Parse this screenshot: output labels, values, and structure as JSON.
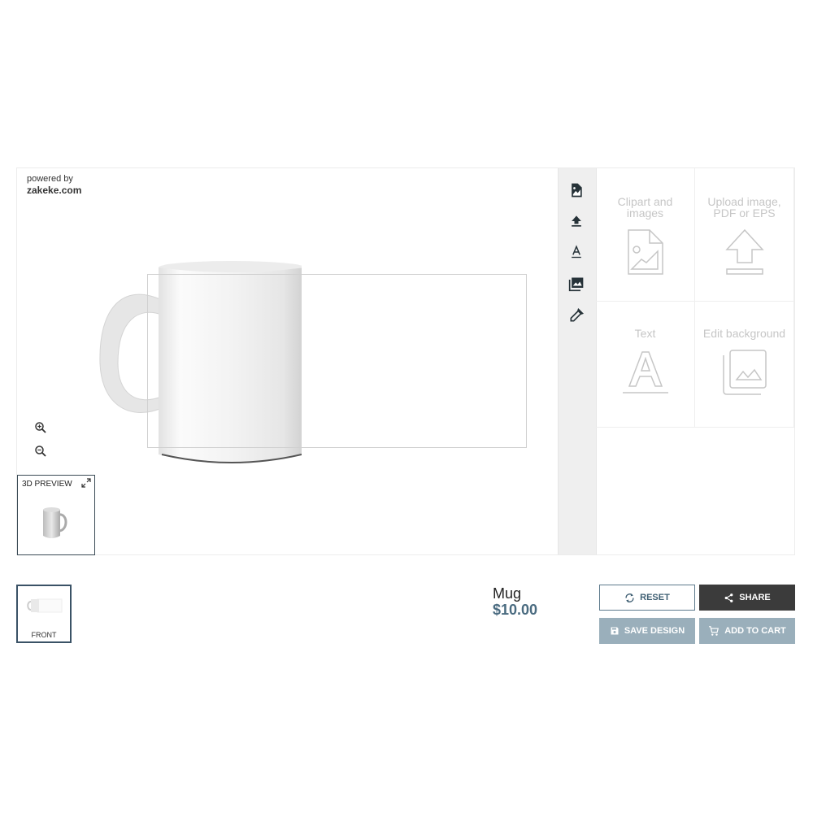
{
  "branding": {
    "powered_by": "powered by",
    "site": "zakeke.com"
  },
  "canvas": {
    "zoom_in_icon": "zoom-in-icon",
    "zoom_out_icon": "zoom-out-icon",
    "preview_3d": {
      "label": "3D PREVIEW",
      "expand_icon": "expand-icon"
    }
  },
  "toolbar": {
    "tools": [
      {
        "name": "clipart-images",
        "icon": "image-file-icon"
      },
      {
        "name": "upload",
        "icon": "upload-icon"
      },
      {
        "name": "text",
        "icon": "text-icon"
      },
      {
        "name": "edit-background",
        "icon": "photo-library-icon"
      },
      {
        "name": "color-picker",
        "icon": "eyedropper-icon"
      }
    ]
  },
  "panel": {
    "tiles": [
      {
        "label": "Clipart and images",
        "icon": "image-file-icon"
      },
      {
        "label": "Upload image, PDF or EPS",
        "icon": "upload-icon"
      },
      {
        "label": "Text",
        "icon": "text-icon"
      },
      {
        "label": "Edit background",
        "icon": "photo-library-icon"
      }
    ]
  },
  "sides": [
    {
      "label": "FRONT",
      "selected": true
    }
  ],
  "product": {
    "name": "Mug",
    "price": "$10.00"
  },
  "actions": {
    "reset": "RESET",
    "share": "SHARE",
    "save_design": "SAVE DESIGN",
    "add_to_cart": "ADD TO CART"
  },
  "colors": {
    "accent": "#4a6b80",
    "share_bg": "#3b3b3b",
    "disabled_btn_bg": "#9aafbb",
    "toolbar_bg": "#efefef"
  }
}
